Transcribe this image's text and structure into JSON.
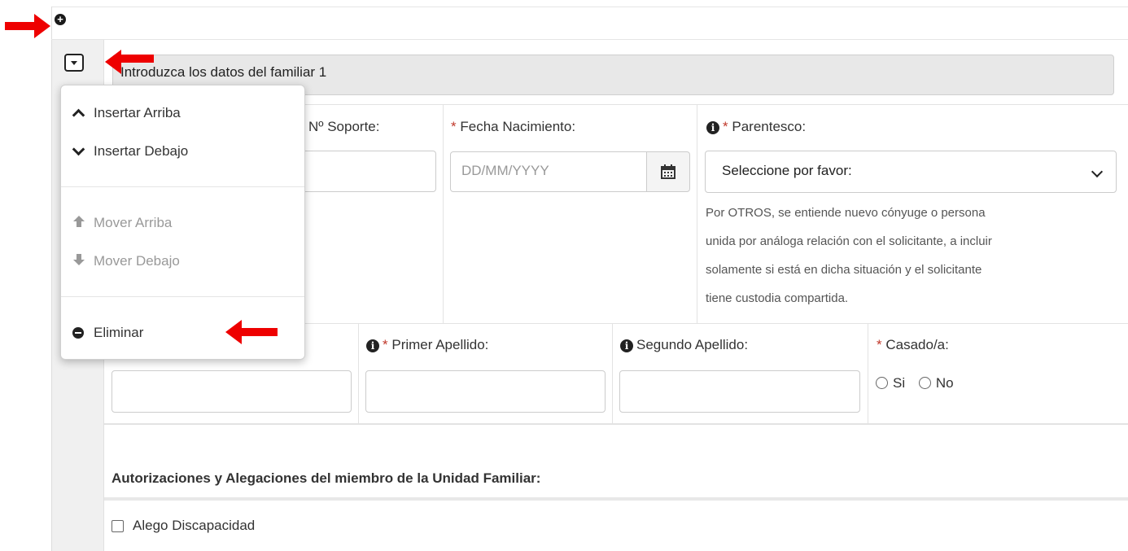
{
  "panel": {
    "header_title": "Introduzca los datos del familiar 1"
  },
  "fields": {
    "soporte_label": "Nº Soporte:",
    "fecha_label": "Fecha Nacimiento:",
    "fecha_placeholder": "DD/MM/YYYY",
    "parentesco_label": "Parentesco:",
    "parentesco_value": "Seleccione por favor:",
    "parentesco_help": [
      "Por OTROS, se entiende nuevo cónyuge o persona",
      "unida por análoga relación con el solicitante, a incluir",
      "solamente si está en dicha situación y el solicitante",
      "tiene custodia compartida."
    ],
    "primer_apellido_label": "Primer Apellido:",
    "segundo_apellido_label": "Segundo Apellido:",
    "casado_label": "Casado/a:",
    "radio_si": "Si",
    "radio_no": "No",
    "required_mark": "*"
  },
  "section": {
    "title": "Autorizaciones y Alegaciones del miembro de la Unidad Familiar:",
    "checkbox_label": "Alego Discapacidad"
  },
  "menu": {
    "insert_above": "Insertar Arriba",
    "insert_below": "Insertar Debajo",
    "move_up": "Mover Arriba",
    "move_down": "Mover Debajo",
    "delete": "Eliminar"
  },
  "icons": {
    "add": "plus-circle-icon",
    "toggle": "caret-down-square-icon",
    "calendar": "calendar-icon",
    "info": "info-circle-icon",
    "arrow": "red-arrow-annotation"
  },
  "colors": {
    "required": "#c0392b",
    "annotation_arrow": "#ee0000",
    "disabled_text": "#999999",
    "header_bg": "#e8e8e8"
  }
}
